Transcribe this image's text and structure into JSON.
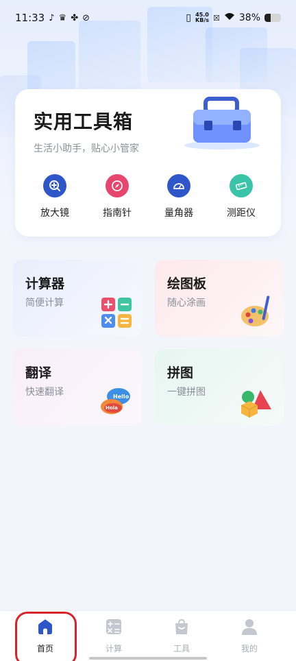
{
  "status_bar": {
    "time": "11:33",
    "net_speed_value": "45.0",
    "net_speed_unit": "KB/s",
    "battery_percent": "38%",
    "battery_level": 0.38
  },
  "toolbox": {
    "title": "实用工具箱",
    "subtitle": "生活小助手，贴心小管家",
    "tools": [
      {
        "label": "放大镜",
        "icon": "magnifier-icon",
        "color": "#2f56c9"
      },
      {
        "label": "指南针",
        "icon": "compass-icon",
        "color": "#e6466d"
      },
      {
        "label": "量角器",
        "icon": "protractor-icon",
        "color": "#2f56c9"
      },
      {
        "label": "测距仪",
        "icon": "ruler-icon",
        "color": "#39c3a8"
      }
    ]
  },
  "features": [
    {
      "title": "计算器",
      "subtitle": "简便计算",
      "icon": "calculator-icon"
    },
    {
      "title": "绘图板",
      "subtitle": "随心涂画",
      "icon": "palette-icon"
    },
    {
      "title": "翻译",
      "subtitle": "快速翻译",
      "icon": "translate-bubbles-icon",
      "bubble_words": [
        "Hello",
        "Hola"
      ]
    },
    {
      "title": "拼图",
      "subtitle": "一键拼图",
      "icon": "shapes-icon"
    }
  ],
  "tabbar": {
    "tabs": [
      {
        "label": "首页",
        "icon": "home-icon",
        "active": true
      },
      {
        "label": "计算",
        "icon": "calculator-tab-icon",
        "active": false
      },
      {
        "label": "工具",
        "icon": "bag-icon",
        "active": false
      },
      {
        "label": "我的",
        "icon": "person-icon",
        "active": false
      }
    ],
    "active_color": "#2f56c9",
    "inactive_color": "#c4c7cf"
  }
}
